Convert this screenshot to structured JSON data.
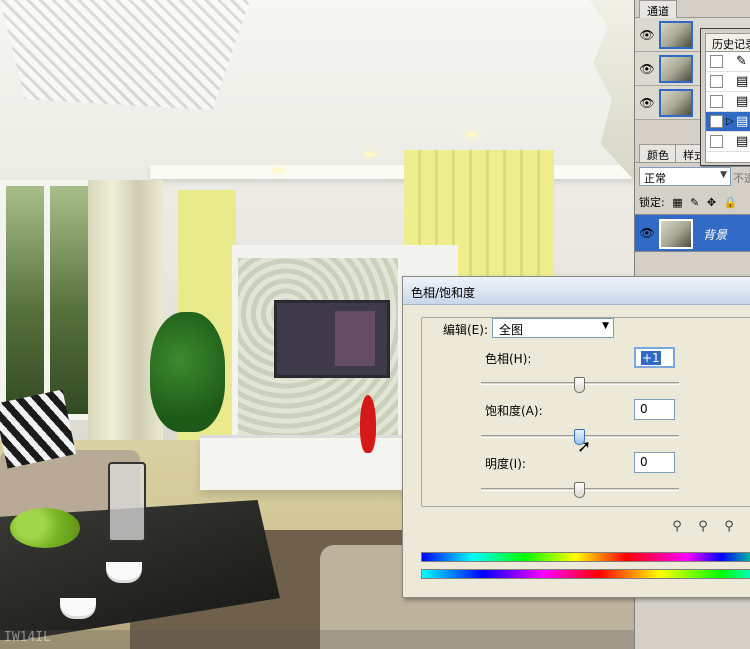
{
  "panels": {
    "channels_tab": "通道",
    "history_tab": "历史记录",
    "swatch_tabs": [
      "颜色",
      "样式"
    ],
    "blend_mode": "正常",
    "opacity_label": "不透明",
    "lock_label": "锁定:",
    "layer_name": "背景"
  },
  "dialog": {
    "title": "色相/饱和度",
    "edit_label": "编辑(E):",
    "edit_value": "全图",
    "hue_label": "色相(H):",
    "hue_value": "+1",
    "saturation_label": "饱和度(A):",
    "saturation_value": "0",
    "lightness_label": "明度(I):",
    "lightness_value": "0"
  },
  "watermark": "IW14IL",
  "icons": {
    "eye": "eye-icon",
    "eyedropper": "eyedropper-icon",
    "eyedropper_plus": "eyedropper-plus-icon",
    "eyedropper_minus": "eyedropper-minus-icon",
    "history_step": "history-step-icon",
    "lock": "lock-icon"
  },
  "colors": {
    "selection": "#316ac5",
    "dialog_bg": "#ece9d8",
    "panel_bg": "#d4d0c8"
  }
}
